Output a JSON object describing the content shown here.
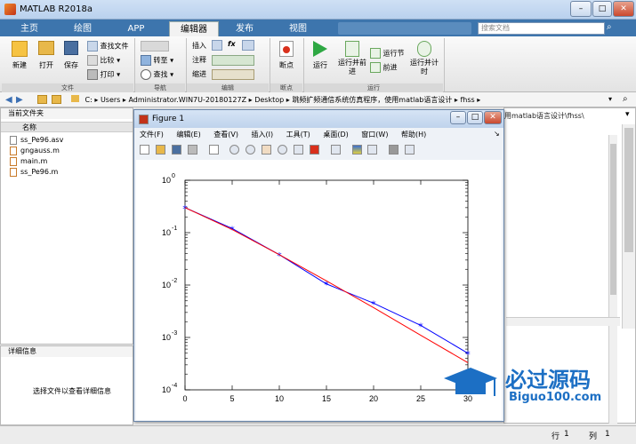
{
  "app": {
    "title": "MATLAB R2018a"
  },
  "tabs": [
    "主页",
    "绘图",
    "APP",
    "编辑器",
    "发布",
    "视图"
  ],
  "search": {
    "placeholder": "搜索文档"
  },
  "ribbon": {
    "file_group": {
      "new": "新建",
      "open": "打开",
      "save": "保存",
      "find_files": "查找文件",
      "compare": "比较",
      "print": "打印",
      "label": "文件"
    },
    "nav_group": {
      "goto": "转至",
      "find": "查找",
      "label": "导航"
    },
    "edit_group": {
      "insert": "插入",
      "comment": "注释",
      "indent": "缩进",
      "fx": "fx",
      "label": "编辑"
    },
    "breakpoint_group": {
      "breakpoints": "断点",
      "label": "断点"
    },
    "run_group": {
      "run": "运行",
      "run_advance": "运行并前进",
      "run_section": "运行节",
      "advance": "前进",
      "run_time": "运行并计时",
      "label": "运行"
    }
  },
  "address": {
    "path": [
      "C:",
      "Users",
      "Administrator.WIN7U-20180127Z",
      "Desktop",
      "跳频扩频通信系统仿真程序，使用matlab语言设计",
      "fhss"
    ],
    "right_fragment": "用matlab语言设计\\fhss\\"
  },
  "current_folder": {
    "title": "当前文件夹",
    "column_name": "名称",
    "files": [
      "ss_Pe96.asv",
      "gngauss.m",
      "main.m",
      "ss_Pe96.m"
    ]
  },
  "details": {
    "title": "详细信息",
    "message": "选择文件以查看详细信息"
  },
  "figure": {
    "title": "Figure 1",
    "menu": [
      "文件(F)",
      "编辑(E)",
      "查看(V)",
      "插入(I)",
      "工具(T)",
      "桌面(D)",
      "窗口(W)",
      "帮助(H)"
    ]
  },
  "chart_data": {
    "type": "line",
    "yscale": "log",
    "xlim": [
      0,
      30
    ],
    "ylim": [
      0.0001,
      1
    ],
    "xticks": [
      0,
      5,
      10,
      15,
      20,
      25,
      30
    ],
    "yticks": [
      1,
      0.1,
      0.01,
      0.001,
      0.0001
    ],
    "ytick_labels": [
      "10^0",
      "10^-1",
      "10^-2",
      "10^-3",
      "10^-4"
    ],
    "series": [
      {
        "color": "#0000ff",
        "marker": "*",
        "x": [
          0,
          5,
          10,
          15,
          20,
          25,
          30
        ],
        "y": [
          0.3,
          0.12,
          0.038,
          0.0105,
          0.0045,
          0.0017,
          0.0005
        ]
      },
      {
        "color": "#ff0000",
        "marker": "none",
        "x": [
          0,
          5,
          10,
          15,
          20,
          25,
          30
        ],
        "y": [
          0.3,
          0.115,
          0.038,
          0.012,
          0.0037,
          0.0011,
          0.00033
        ]
      }
    ]
  },
  "status": {
    "row_label": "行",
    "row_value": "1",
    "col_label": "列",
    "col_value": "1"
  },
  "watermark": {
    "cn": "必过源码",
    "en": "Biguo100.com"
  },
  "colors": {
    "tabstrip": "#3d75ad",
    "series_blue": "#0000ff",
    "series_red": "#ff0000",
    "watermark": "#1c6fc4"
  }
}
